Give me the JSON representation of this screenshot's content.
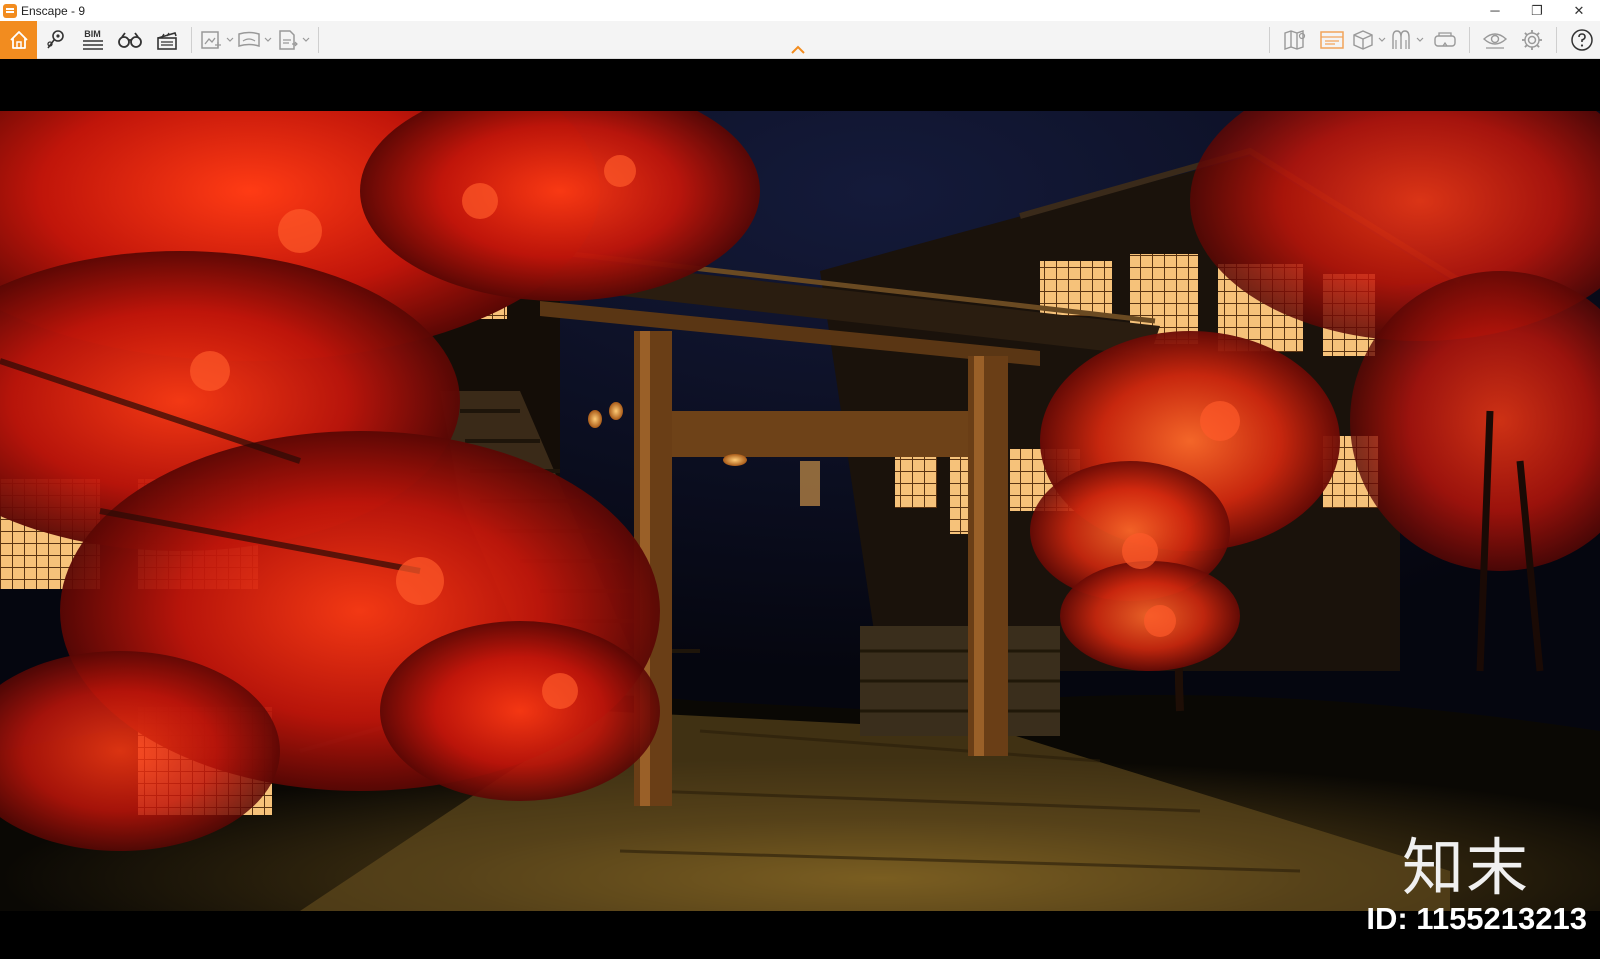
{
  "window": {
    "title": "Enscape - 9",
    "controls": {
      "minimize": "─",
      "restore": "❐",
      "close": "✕"
    }
  },
  "toolbar": {
    "bim_label": "BIM",
    "accent_color": "#f28c1f",
    "left_icons": [
      "home-icon",
      "location-pin-icon",
      "bim-icon",
      "binoculars-icon",
      "clapperboard-icon",
      "screenshot-export-icon",
      "panorama-360-icon",
      "exe-export-icon"
    ],
    "right_icons": [
      "map-icon",
      "asset-library-icon",
      "cube-icon",
      "atmosphere-icon",
      "vr-headset-icon",
      "eye-icon",
      "gear-icon",
      "help-icon"
    ]
  },
  "viewport": {
    "brand_mark": "知末",
    "id_label": "ID: 1155213213"
  }
}
